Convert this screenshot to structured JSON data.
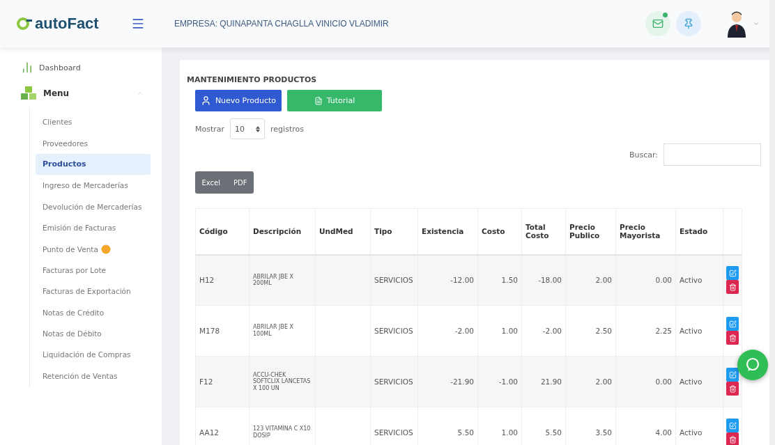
{
  "header": {
    "brand": "autoFact",
    "company": "EMPRESA: QUINAPANTA CHAGLLA VINICIO VLADIMIR",
    "mail_unread": true
  },
  "sidebar": {
    "items": [
      {
        "label": "Dashboard",
        "kind": "top"
      },
      {
        "label": "Menu",
        "kind": "group",
        "expanded": true,
        "children": [
          {
            "label": "Clientes",
            "selected": false,
            "badge": false
          },
          {
            "label": "Proveedores",
            "selected": false,
            "badge": false
          },
          {
            "label": "Productos",
            "selected": true,
            "badge": false
          },
          {
            "label": "Ingreso de Mercaderías",
            "selected": false,
            "badge": false
          },
          {
            "label": "Devolución de Mercaderías",
            "selected": false,
            "badge": false
          },
          {
            "label": "Emisión de Facturas",
            "selected": false,
            "badge": false
          },
          {
            "label": "Punto de Venta",
            "selected": false,
            "badge": true
          },
          {
            "label": "Facturas por Lote",
            "selected": false,
            "badge": false
          },
          {
            "label": "Facturas de Exportación",
            "selected": false,
            "badge": false
          },
          {
            "label": "Notas de Crédito",
            "selected": false,
            "badge": false
          },
          {
            "label": "Notas de Débito",
            "selected": false,
            "badge": false
          },
          {
            "label": "Liquidación de Compras",
            "selected": false,
            "badge": false
          },
          {
            "label": "Retención de Ventas",
            "selected": false,
            "badge": false
          }
        ]
      }
    ]
  },
  "page": {
    "title": "MANTENIMIENTO PRODUCTOS",
    "buttons": [
      {
        "label": "Nuevo Producto",
        "kind": "primary"
      },
      {
        "label": "Tutorial",
        "kind": "success"
      }
    ],
    "length": {
      "prefix": "Mostrar",
      "value": "10",
      "suffix": "registros"
    },
    "search": {
      "label": "Buscar:"
    },
    "exports": [
      "Excel",
      "PDF"
    ]
  },
  "table": {
    "columns": [
      "Código",
      "Descripción",
      "UndMed",
      "Tipo",
      "Existencia",
      "Costo",
      "Total Costo",
      "Precio Publico",
      "Precio Mayorista",
      "Estado"
    ],
    "rows": [
      {
        "cells": [
          "H12",
          "ABRILAR JBE X 200ML",
          "",
          "SERVICIOS",
          "-12.00",
          "1.50",
          "-18.00",
          "2.00",
          "0.00",
          "Activo"
        ]
      },
      {
        "cells": [
          "M178",
          "ABRILAR JBE X 100ML",
          "",
          "SERVICIOS",
          "-2.00",
          "1.00",
          "-2.00",
          "2.50",
          "2.25",
          "Activo"
        ]
      },
      {
        "cells": [
          "F12",
          "ACCU-CHEK SOFTCLIX LANCETAS X 100 UN",
          "",
          "SERVICIOS",
          "-21.90",
          "-1.00",
          "21.90",
          "2.00",
          "0.00",
          "Activo"
        ]
      },
      {
        "cells": [
          "AA12",
          "123 VITAMINA C X10 DOSIP",
          "",
          "SERVICIOS",
          "5.50",
          "1.00",
          "5.50",
          "3.50",
          "4.00",
          "Activo"
        ]
      }
    ]
  }
}
